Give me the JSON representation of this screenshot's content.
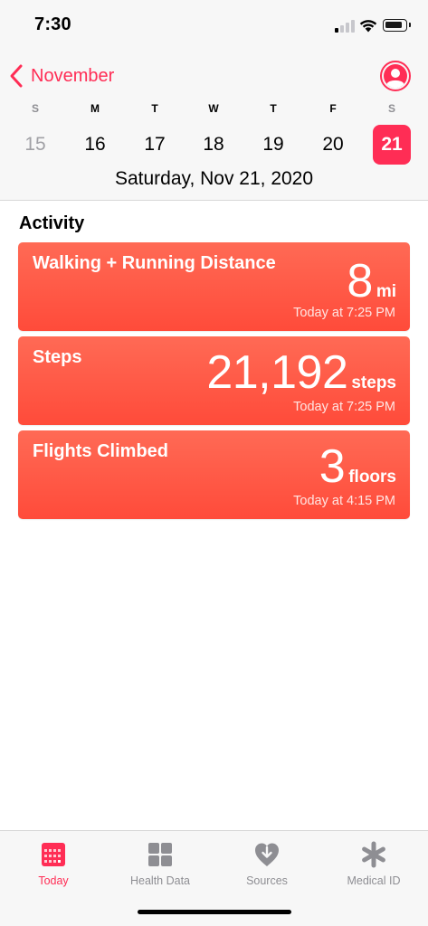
{
  "status_bar": {
    "time": "7:30",
    "signal_bars_active": 1,
    "signal_bars_total": 4,
    "battery_level": 0.8
  },
  "header": {
    "back_label": "November",
    "avatar_icon": "person-icon"
  },
  "week": {
    "weekdays": [
      "S",
      "M",
      "T",
      "W",
      "T",
      "F",
      "S"
    ],
    "days": [
      "15",
      "16",
      "17",
      "18",
      "19",
      "20",
      "21"
    ],
    "selected_index": 6,
    "date_label": "Saturday, Nov 21, 2020"
  },
  "activity": {
    "title": "Activity",
    "cards": [
      {
        "title": "Walking + Running Distance",
        "value": "8",
        "unit": "mi",
        "time": "Today at 7:25 PM"
      },
      {
        "title": "Steps",
        "value": "21,192",
        "unit": "steps",
        "time": "Today at 7:25 PM"
      },
      {
        "title": "Flights Climbed",
        "value": "3",
        "unit": "floors",
        "time": "Today at 4:15 PM"
      }
    ]
  },
  "tabbar": {
    "tabs": [
      {
        "label": "Today",
        "icon": "calendar-icon",
        "active": true
      },
      {
        "label": "Health Data",
        "icon": "grid-icon",
        "active": false
      },
      {
        "label": "Sources",
        "icon": "heart-download-icon",
        "active": false
      },
      {
        "label": "Medical ID",
        "icon": "asterisk-icon",
        "active": false
      }
    ]
  },
  "colors": {
    "accent": "#ff2d55",
    "card_top": "#ff6a55",
    "card_bottom": "#ff4b3a",
    "inactive_gray": "#8e8e93"
  }
}
